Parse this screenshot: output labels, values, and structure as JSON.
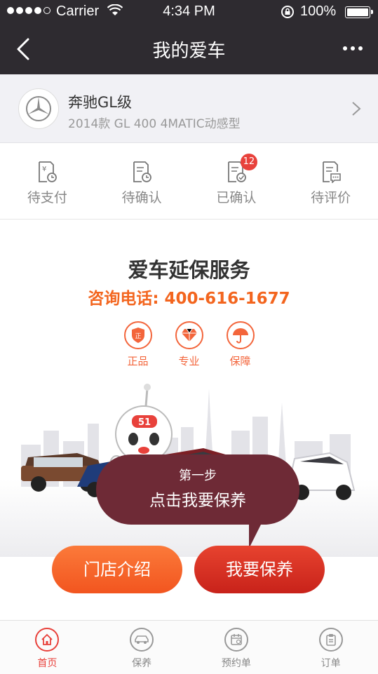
{
  "status_bar": {
    "carrier": "Carrier",
    "time": "4:34 PM",
    "battery": "100%",
    "battery_level": 1.0,
    "signal_bars_filled": 4,
    "signal_bars_total": 5
  },
  "nav": {
    "title": "我的爱车",
    "back_icon": "chevron-left-icon",
    "more_icon": "more-dots-icon"
  },
  "car": {
    "name": "奔驰GL级",
    "model": "2014款 GL 400 4MATIC动感型",
    "logo_icon": "mercedes-logo"
  },
  "orders": [
    {
      "label": "待支付",
      "icon": "yuan-clock-doc-icon",
      "badge": ""
    },
    {
      "label": "待确认",
      "icon": "clock-doc-icon",
      "badge": ""
    },
    {
      "label": "已确认",
      "icon": "check-doc-icon",
      "badge": "12"
    },
    {
      "label": "待评价",
      "icon": "comment-doc-icon",
      "badge": ""
    }
  ],
  "service": {
    "title": "爱车延保服务",
    "phone": "咨询电话: 400-616-1677",
    "features": [
      {
        "label": "正品",
        "icon": "shield-icon",
        "mark": "正"
      },
      {
        "label": "专业",
        "icon": "diamond-icon"
      },
      {
        "label": "保障",
        "icon": "umbrella-icon"
      }
    ],
    "mascot_badge": "51",
    "tooltip": {
      "step": "第一步",
      "text": "点击我要保养"
    },
    "buttons": {
      "store": "门店介绍",
      "book": "我要保养"
    }
  },
  "tabs": [
    {
      "label": "首页",
      "icon": "home-icon",
      "active": true
    },
    {
      "label": "保养",
      "icon": "car-icon",
      "active": false
    },
    {
      "label": "预约单",
      "icon": "calendar-icon",
      "active": false
    },
    {
      "label": "订单",
      "icon": "clipboard-icon",
      "active": false
    }
  ],
  "colors": {
    "nav_bg": "#2e2b30",
    "accent_orange": "#f3651e",
    "accent_red": "#e8413b",
    "tooltip_bg": "#6e2a36"
  }
}
